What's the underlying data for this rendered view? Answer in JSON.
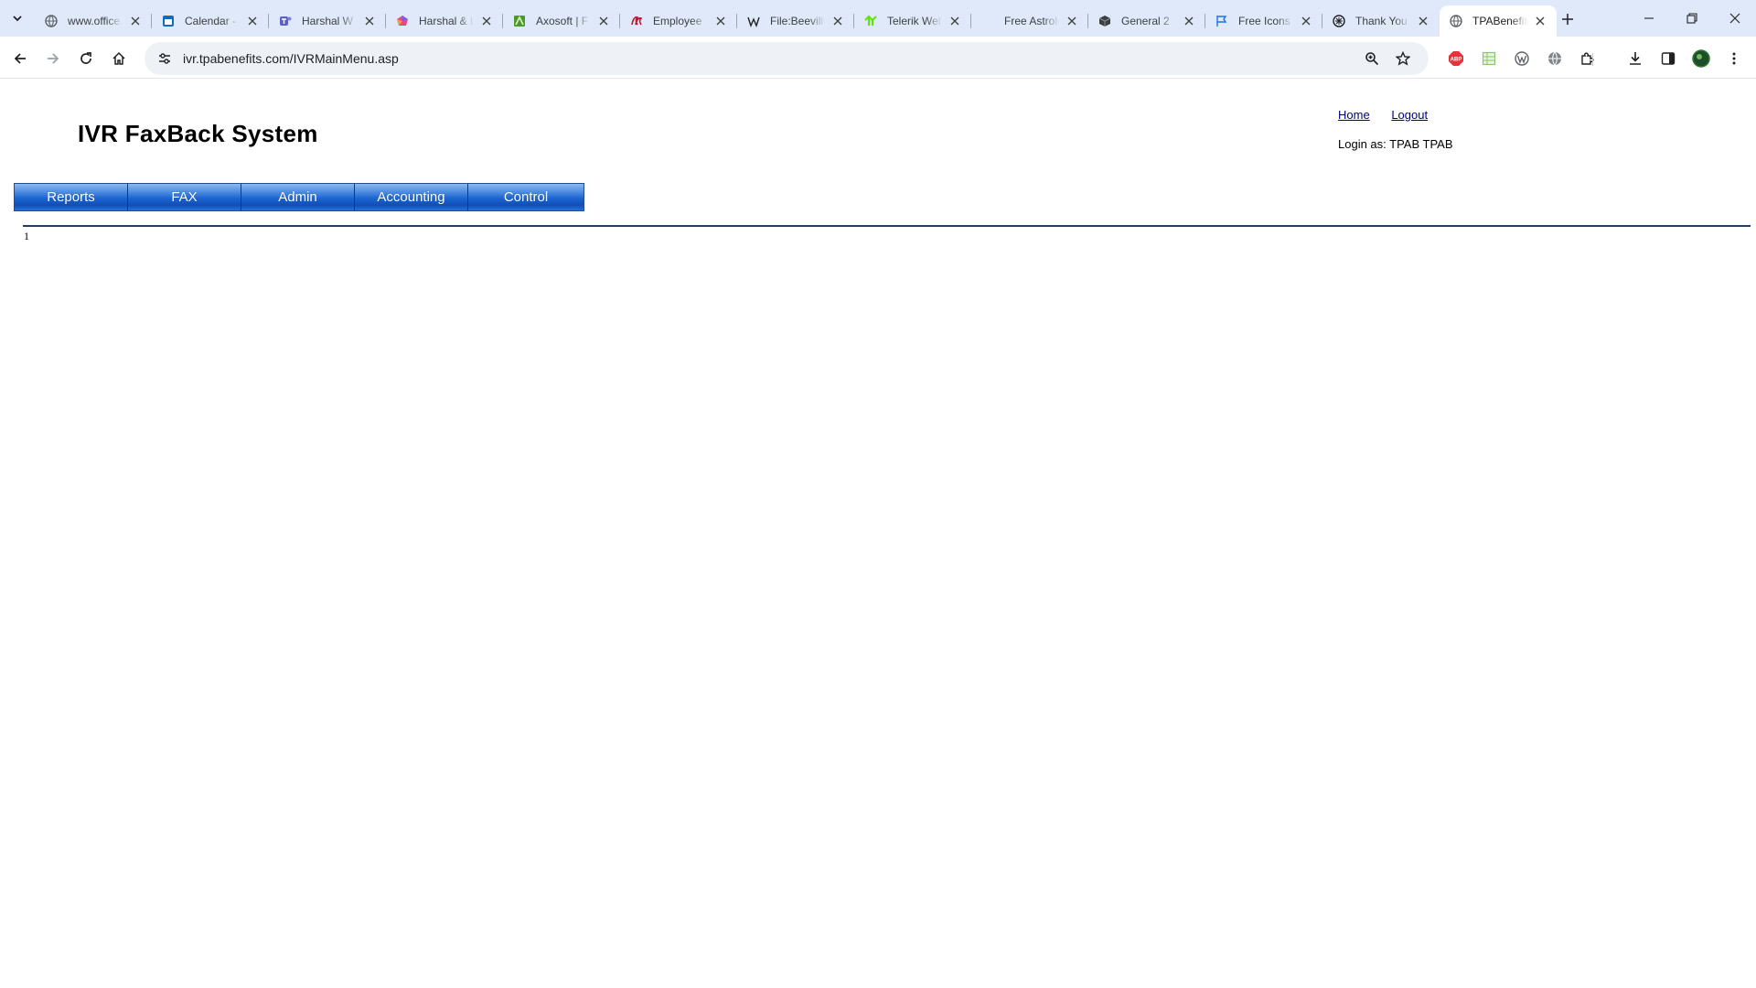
{
  "browser": {
    "tabs": [
      {
        "title": "www.office.com",
        "favicon": "globe-icon"
      },
      {
        "title": "Calendar - Outlook",
        "favicon": "calendar-icon"
      },
      {
        "title": "Harshal W - Teams",
        "favicon": "teams-icon"
      },
      {
        "title": "Harshal & Loop",
        "favicon": "loop-icon"
      },
      {
        "title": "Axosoft | F",
        "favicon": "axosoft-icon"
      },
      {
        "title": "Employee",
        "favicon": "employee-icon"
      },
      {
        "title": "File:Beeville",
        "favicon": "wikipedia-icon"
      },
      {
        "title": "Telerik Web",
        "favicon": "telerik-icon"
      },
      {
        "title": "Free Astrology",
        "favicon": "astro-icon"
      },
      {
        "title": "General 2",
        "favicon": "cube-icon"
      },
      {
        "title": "Free Icons",
        "favicon": "flag-icon"
      },
      {
        "title": "Thank You",
        "favicon": "thankyou-icon"
      },
      {
        "title": "TPABenefits",
        "favicon": "globe-icon",
        "active": true
      }
    ],
    "url": "ivr.tpabenefits.com/IVRMainMenu.asp"
  },
  "page": {
    "title": "IVR FaxBack System",
    "links": {
      "home": "Home",
      "logout": "Logout"
    },
    "login_label": "Login as: TPAB TPAB",
    "menu": [
      "Reports",
      "FAX",
      "Admin",
      "Accounting",
      "Control"
    ],
    "content": "1"
  }
}
